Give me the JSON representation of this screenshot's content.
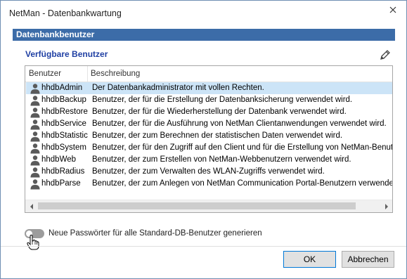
{
  "window": {
    "title": "NetMan - Datenbankwartung"
  },
  "section": {
    "header": "Datenbankbenutzer",
    "subtitle": "Verfügbare Benutzer"
  },
  "table": {
    "columns": [
      "Benutzer",
      "Beschreibung"
    ],
    "rows": [
      {
        "name": "hhdbAdmin",
        "description": "Der Datenbankadministrator mit vollen Rechten.",
        "selected": true
      },
      {
        "name": "hhdbBackup",
        "description": "Benutzer, der für die Erstellung der Datenbanksicherung verwendet wird."
      },
      {
        "name": "hhdbRestore",
        "description": "Benutzer, der für die Wiederherstellung der Datenbank verwendet wird."
      },
      {
        "name": "hhdbService",
        "description": "Benutzer, der für die Ausführung von NetMan Clientanwendungen verwendet wird."
      },
      {
        "name": "hhdbStatistic",
        "description": "Benutzer, der zum Berechnen der statistischen Daten verwendet wird."
      },
      {
        "name": "hhdbSystem",
        "description": "Benutzer, der für den Zugriff auf den Client und für die Erstellung von NetMan-Benutzern"
      },
      {
        "name": "hhdbWeb",
        "description": "Benutzer, der zum Erstellen von NetMan-Webbenutzern verwendet wird."
      },
      {
        "name": "hhdbRadius",
        "description": "Benutzer, der zum Verwalten des WLAN-Zugriffs verwendet wird."
      },
      {
        "name": "hhdbParse",
        "description": "Benutzer, der zum Anlegen von NetMan Communication Portal-Benutzern verwendet wird"
      }
    ]
  },
  "toggle": {
    "label": "Neue Passwörter für alle Standard-DB-Benutzer generieren",
    "on": false
  },
  "buttons": {
    "ok": "OK",
    "cancel": "Abbrechen"
  },
  "icons": {
    "close": "close-icon",
    "edit": "pencil-icon",
    "user": "user-icon",
    "scroll_left": "chevron-left-icon",
    "scroll_right": "chevron-right-icon",
    "cursor": "hand-cursor-icon"
  },
  "colors": {
    "section_header_bg": "#3c6ca8",
    "subtitle": "#1f3fa3",
    "selected_row": "#cce4f7",
    "accent_button_border": "#0078d7"
  }
}
